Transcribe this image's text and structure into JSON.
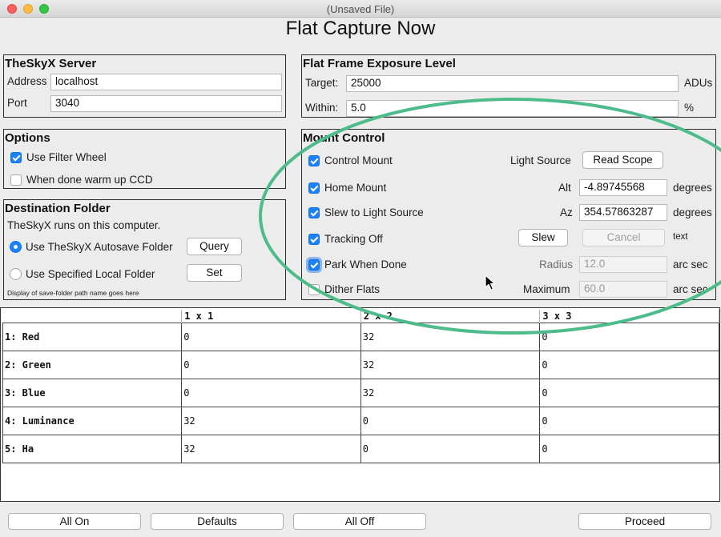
{
  "window": {
    "title": "(Unsaved File)"
  },
  "app_title": "Flat Capture Now",
  "server": {
    "title": "TheSkyX Server",
    "address_label": "Address",
    "address_value": "localhost",
    "port_label": "Port",
    "port_value": "3040"
  },
  "options": {
    "title": "Options",
    "use_filter_wheel": {
      "label": "Use Filter Wheel",
      "checked": true
    },
    "warm_up_ccd": {
      "label": "When done warm up CCD",
      "checked": false
    }
  },
  "destination": {
    "title": "Destination Folder",
    "note": "TheSkyX runs on this computer.",
    "autosave_label": "Use TheSkyX Autosave Folder",
    "query_button": "Query",
    "local_label": "Use Specified Local Folder",
    "set_button": "Set",
    "path_display": "Display of save-folder path name goes here",
    "selected": "autosave"
  },
  "exposure": {
    "title": "Flat Frame Exposure Level",
    "target_label": "Target:",
    "target_value": "25000",
    "target_unit": "ADUs",
    "within_label": "Within:",
    "within_value": "5.0",
    "within_unit": "%"
  },
  "mount": {
    "title": "Mount Control",
    "control_mount": "Control Mount",
    "home_mount": "Home Mount",
    "slew_to_light": "Slew to Light Source",
    "tracking_off": "Tracking Off",
    "park_when_done": "Park When Done",
    "dither_flats": "Dither Flats",
    "light_source_label": "Light Source",
    "read_scope_button": "Read Scope",
    "alt_label": "Alt",
    "alt_value": "-4.89745568",
    "alt_unit": "degrees",
    "az_label": "Az",
    "az_value": "354.57863287",
    "az_unit": "degrees",
    "slew_button": "Slew",
    "cancel_button": "Cancel",
    "status_text": "text",
    "radius_label": "Radius",
    "radius_value": "12.0",
    "radius_unit": "arc sec",
    "maximum_label": "Maximum",
    "maximum_value": "60.0",
    "maximum_unit": "arc sec"
  },
  "table": {
    "columns": [
      "",
      "1 x 1",
      "2 x 2",
      "3 x 3"
    ],
    "rows": [
      {
        "name": "1: Red",
        "cells": [
          "0",
          "32",
          "0"
        ]
      },
      {
        "name": "2: Green",
        "cells": [
          "0",
          "32",
          "0"
        ]
      },
      {
        "name": "3: Blue",
        "cells": [
          "0",
          "32",
          "0"
        ]
      },
      {
        "name": "4: Luminance",
        "cells": [
          "32",
          "0",
          "0"
        ]
      },
      {
        "name": "5: Ha",
        "cells": [
          "32",
          "0",
          "0"
        ]
      }
    ]
  },
  "footer": {
    "all_on": "All On",
    "defaults": "Defaults",
    "all_off": "All Off",
    "proceed": "Proceed"
  },
  "colors": {
    "accent": "#1a82fb",
    "annotation_ellipse": "#4dbb8a",
    "window_background": "#ececec"
  }
}
